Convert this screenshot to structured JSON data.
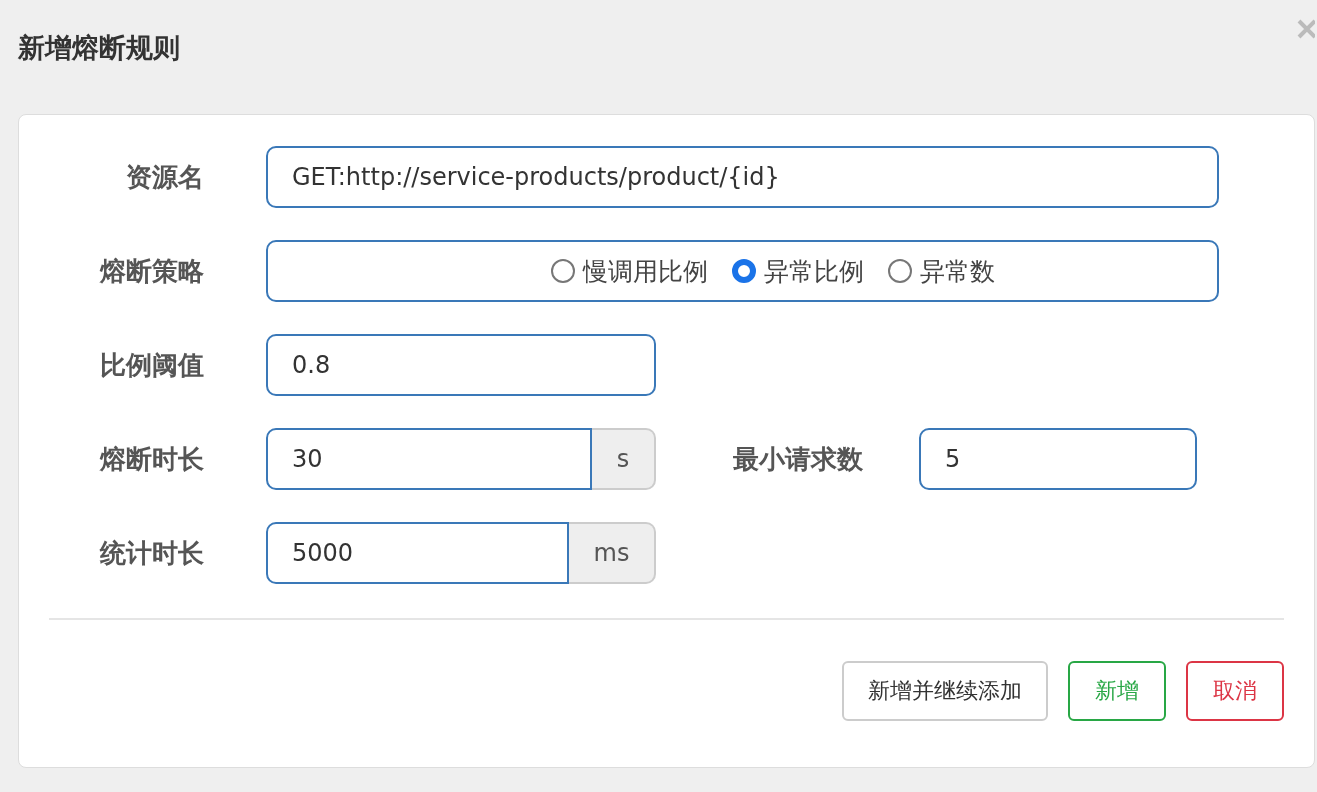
{
  "dialog": {
    "title": "新增熔断规则"
  },
  "resource": {
    "label": "资源名",
    "value": "GET:http://service-products/product/{id}"
  },
  "strategy": {
    "label": "熔断策略",
    "options": [
      {
        "label": "慢调用比例",
        "selected": false
      },
      {
        "label": "异常比例",
        "selected": true
      },
      {
        "label": "异常数",
        "selected": false
      }
    ]
  },
  "ratio_threshold": {
    "label": "比例阈值",
    "value": "0.8"
  },
  "break_duration": {
    "label": "熔断时长",
    "value": "30",
    "unit": "s"
  },
  "min_requests": {
    "label": "最小请求数",
    "value": "5"
  },
  "stat_duration": {
    "label": "统计时长",
    "value": "5000",
    "unit": "ms"
  },
  "buttons": [
    {
      "label": "新增并继续添加",
      "kind": "default"
    },
    {
      "label": "新增",
      "kind": "success"
    },
    {
      "label": "取消",
      "kind": "danger"
    }
  ]
}
